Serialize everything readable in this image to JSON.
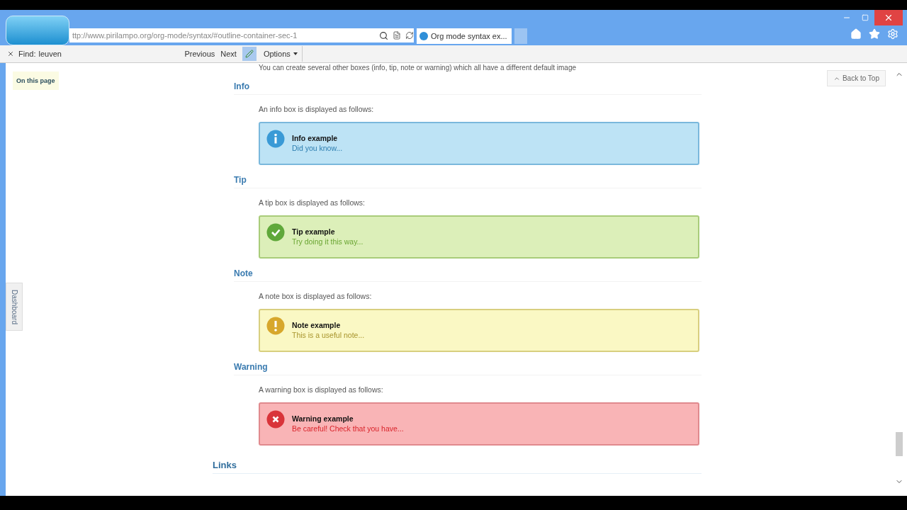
{
  "browser": {
    "address": "ttp://www.pirilampo.org/org-mode/syntax/#outline-container-sec-1",
    "tab_title": "Org mode syntax ex..."
  },
  "find_bar": {
    "label": "Find:",
    "value": "leuven",
    "buttons": [
      "Previous",
      "Next"
    ],
    "options": "Options"
  },
  "sidebar": {
    "toc_label": "On this page",
    "dashboard_tab": "Dashboard"
  },
  "back_to_top": "Back to Top",
  "intro": "You can create several other boxes (info, tip, note or warning) which all have a different default image",
  "sections": [
    {
      "heading": "Info",
      "description": "An info box is displayed as follows:",
      "box": {
        "kind": "info",
        "title": "Info example",
        "text": "Did you know..."
      }
    },
    {
      "heading": "Tip",
      "description": "A tip box is displayed as follows:",
      "box": {
        "kind": "tip",
        "title": "Tip example",
        "text": "Try doing it this way..."
      }
    },
    {
      "heading": "Note",
      "description": "A note box is displayed as follows:",
      "box": {
        "kind": "note",
        "title": "Note example",
        "text": "This is a useful note..."
      }
    },
    {
      "heading": "Warning",
      "description": "A warning box is displayed as follows:",
      "box": {
        "kind": "warning",
        "title": "Warning example",
        "text": "Be careful! Check that you have..."
      }
    }
  ],
  "next_heading": "Links"
}
